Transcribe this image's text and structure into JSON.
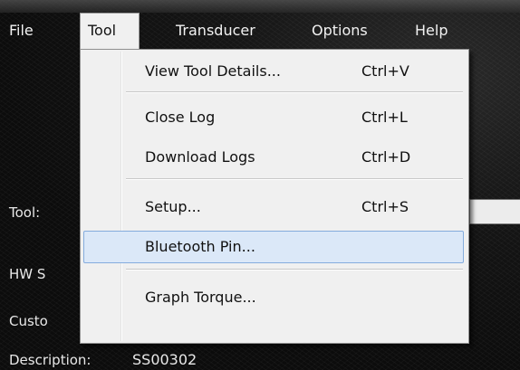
{
  "menubar": {
    "items": [
      {
        "label": "File"
      },
      {
        "label": "Tool"
      },
      {
        "label": "Transducer"
      },
      {
        "label": "Options"
      },
      {
        "label": "Help"
      }
    ]
  },
  "tool_menu": {
    "items": [
      {
        "label": "View Tool Details...",
        "shortcut": "Ctrl+V"
      },
      {
        "label": "Close Log",
        "shortcut": "Ctrl+L"
      },
      {
        "label": "Download Logs",
        "shortcut": "Ctrl+D"
      },
      {
        "label": "Setup...",
        "shortcut": "Ctrl+S"
      },
      {
        "label": "Bluetooth Pin...",
        "shortcut": ""
      },
      {
        "label": "Graph Torque...",
        "shortcut": ""
      }
    ]
  },
  "form": {
    "tool_label": "Tool:",
    "hw_label": "HW S",
    "customer_label": "Custo",
    "description_label": "Description:",
    "description_value": "SS00302"
  },
  "colors": {
    "menu_highlight_bg": "#dbe8f8",
    "menu_highlight_border": "#84acdd",
    "menu_bg": "#f0f0f0",
    "window_bg": "#0d0d0d"
  }
}
